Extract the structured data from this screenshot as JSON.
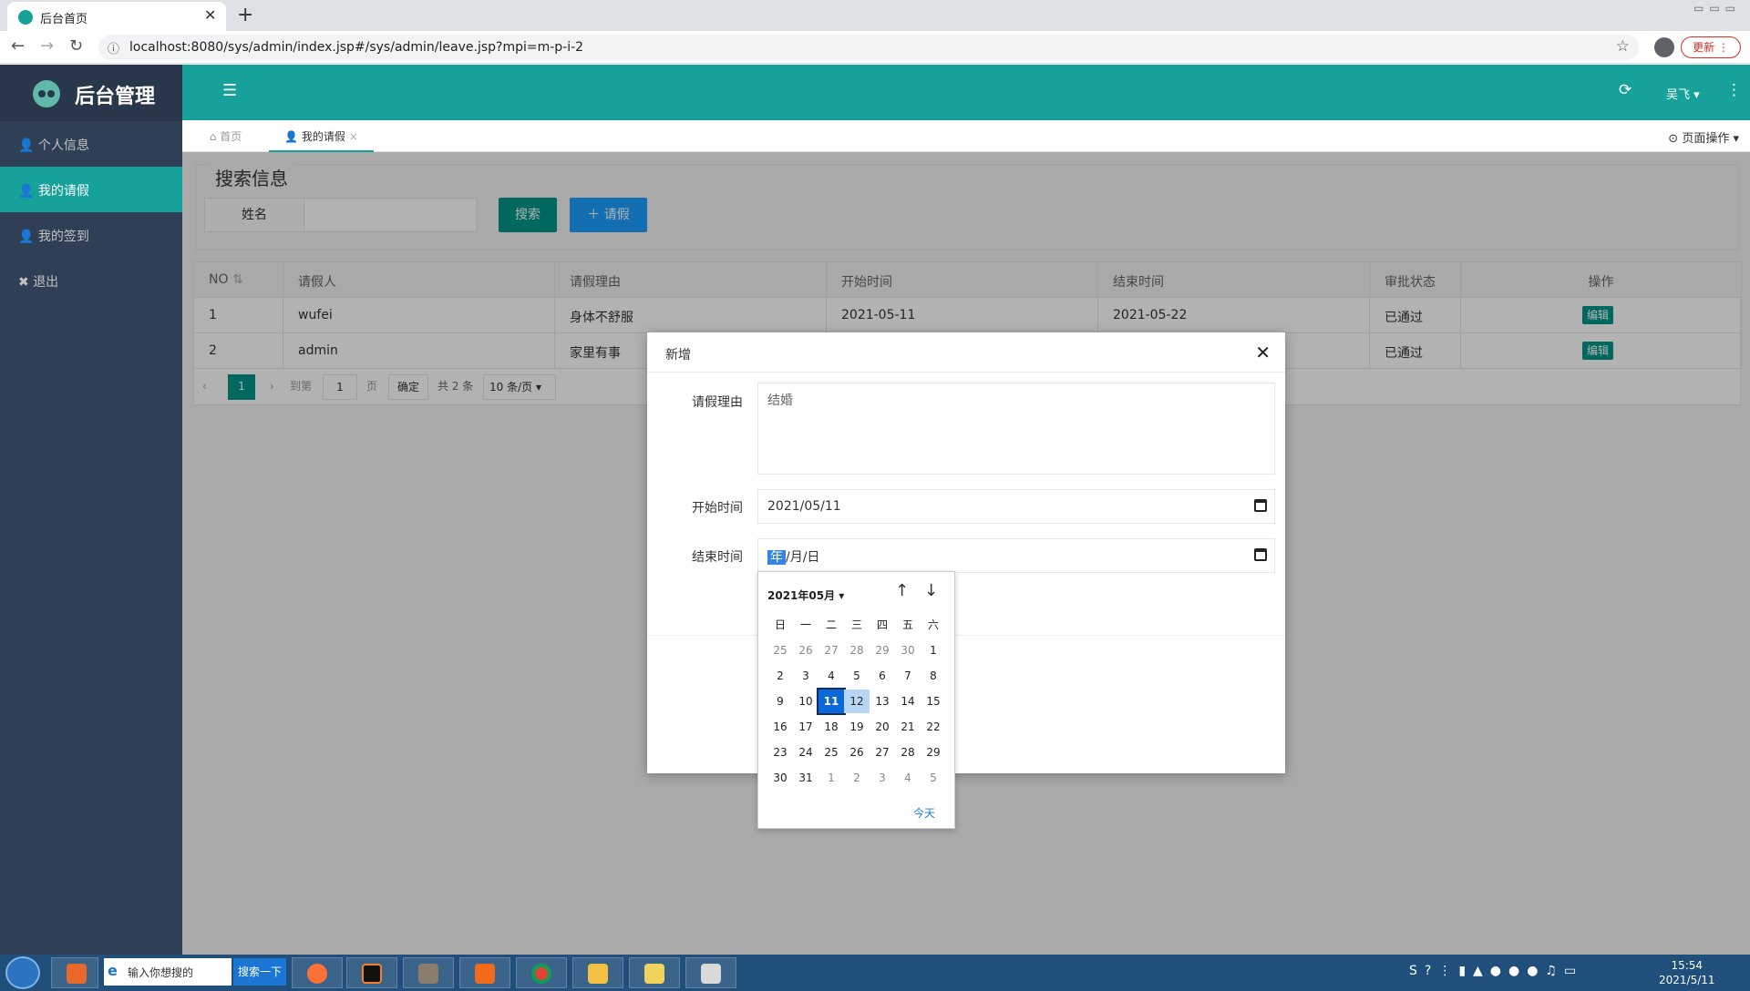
{
  "browser": {
    "tab_title": "后台首页",
    "url": "localhost:8080/sys/admin/index.jsp#/sys/admin/leave.jsp?mpi=m-p-i-2",
    "update_label": "更新"
  },
  "app": {
    "name": "后台管理"
  },
  "sidebar": {
    "items": [
      {
        "label": "个人信息"
      },
      {
        "label": "我的请假"
      },
      {
        "label": "我的签到"
      },
      {
        "label": "退出"
      }
    ]
  },
  "topbar": {
    "user": "吴飞"
  },
  "tabs": [
    {
      "label": "首页"
    },
    {
      "label": "我的请假"
    }
  ],
  "page_ops_label": "页面操作",
  "search": {
    "legend": "搜索信息",
    "name_label": "姓名",
    "search_button": "搜索",
    "leave_button": "请假"
  },
  "table": {
    "columns": [
      "NO",
      "请假人",
      "请假理由",
      "开始时间",
      "结束时间",
      "审批状态",
      "操作"
    ],
    "rows": [
      [
        "1",
        "wufei",
        "身体不舒服",
        "2021-05-11",
        "2021-05-22",
        "已通过",
        "编辑"
      ],
      [
        "2",
        "admin",
        "家里有事",
        "",
        "",
        "已通过",
        "编辑"
      ]
    ]
  },
  "pager": {
    "current": "1",
    "goto_label": "到第",
    "goto_value": "1",
    "page_label": "页",
    "confirm": "确定",
    "total": "共 2 条",
    "page_size": "10 条/页"
  },
  "modal": {
    "title": "新增",
    "reason_label": "请假理由",
    "reason_value": "结婚",
    "start_label": "开始时间",
    "start_value": "2021/05/11",
    "end_label": "结束时间",
    "end_year": "年",
    "end_rest": "/月/日"
  },
  "calendar": {
    "month": "2021年05月",
    "weekdays": [
      "日",
      "一",
      "二",
      "三",
      "四",
      "五",
      "六"
    ],
    "weeks": [
      [
        "25",
        "26",
        "27",
        "28",
        "29",
        "30",
        "1"
      ],
      [
        "2",
        "3",
        "4",
        "5",
        "6",
        "7",
        "8"
      ],
      [
        "9",
        "10",
        "11",
        "12",
        "13",
        "14",
        "15"
      ],
      [
        "16",
        "17",
        "18",
        "19",
        "20",
        "21",
        "22"
      ],
      [
        "23",
        "24",
        "25",
        "26",
        "27",
        "28",
        "29"
      ],
      [
        "30",
        "31",
        "1",
        "2",
        "3",
        "4",
        "5"
      ]
    ],
    "selected": "11",
    "hovered": "12",
    "today_label": "今天"
  },
  "taskbar": {
    "search_placeholder": "输入你想搜的",
    "search_button": "搜索一下",
    "time": "15:54",
    "date": "2021/5/11"
  }
}
